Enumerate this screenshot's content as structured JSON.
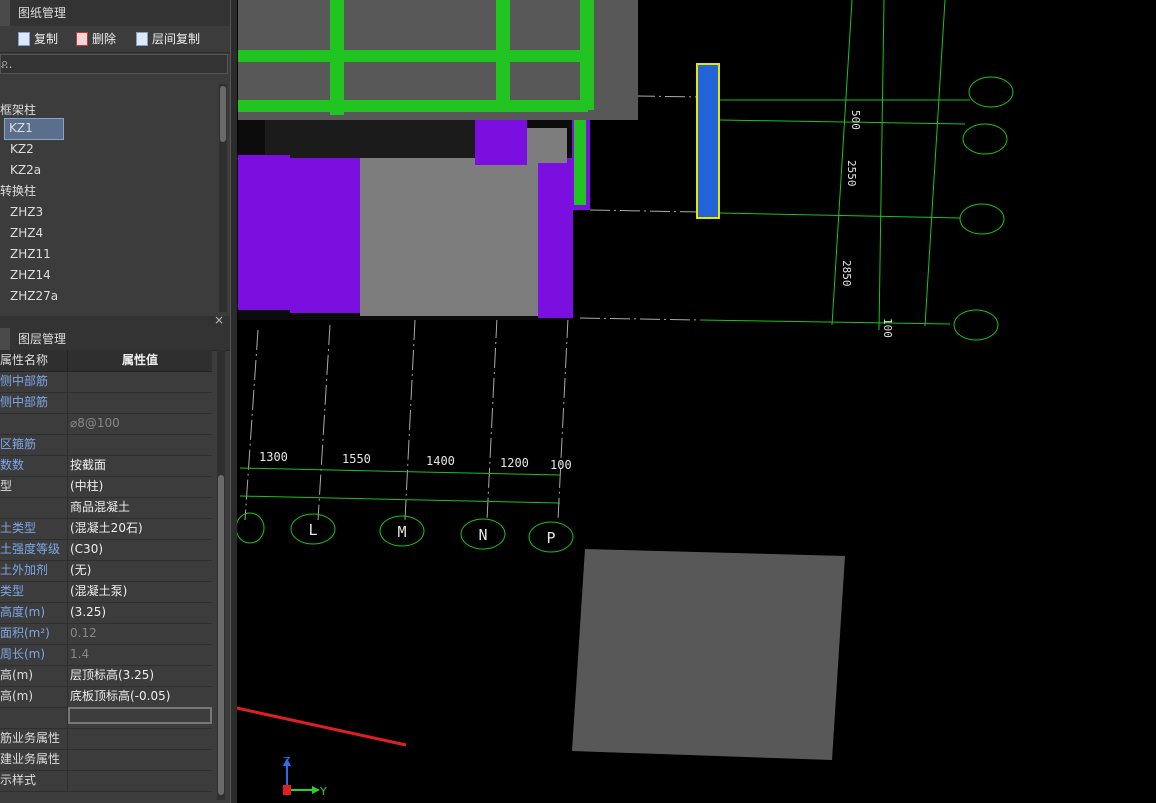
{
  "top_tabs": [
    "图纸管理"
  ],
  "toolbar": {
    "copy_label": "复制",
    "delete_label": "删除",
    "floor_copy_label": "层间复制"
  },
  "search": {
    "value": "..."
  },
  "tree": {
    "group1": "框架柱",
    "items1": [
      "KZ1",
      "KZ2",
      "KZ2a"
    ],
    "group2": "转换柱",
    "items2": [
      "ZHZ3",
      "ZHZ4",
      "ZHZ11",
      "ZHZ14",
      "ZHZ27a"
    ]
  },
  "bottom_tabs": [
    "图层管理"
  ],
  "props": {
    "col_name": "属性名称",
    "col_value": "属性值",
    "rows": [
      {
        "name": "侧中部筋",
        "value": ""
      },
      {
        "name": "侧中部筋",
        "value": ""
      },
      {
        "name": "",
        "value": "⌀8@100"
      },
      {
        "name": "区箍筋",
        "value": ""
      },
      {
        "name": "数数",
        "value": "按截面"
      },
      {
        "name": "型",
        "value": "(中柱)"
      },
      {
        "name": "",
        "value": "商品混凝土"
      },
      {
        "name": "土类型",
        "value": "(混凝土20石)"
      },
      {
        "name": "土强度等级",
        "value": "(C30)"
      },
      {
        "name": "土外加剂",
        "value": "(无)"
      },
      {
        "name": "类型",
        "value": "(混凝土泵)"
      },
      {
        "name": "高度(m)",
        "value": "(3.25)"
      },
      {
        "name": "面积(m²)",
        "value": "0.12"
      },
      {
        "name": "周长(m)",
        "value": "1.4"
      },
      {
        "name": "高(m)",
        "value": "层顶标高(3.25)"
      },
      {
        "name": "高(m)",
        "value": "底板顶标高(-0.05)"
      },
      {
        "name": "",
        "value": ""
      },
      {
        "name": "筋业务属性",
        "value": ""
      },
      {
        "name": "建业务属性",
        "value": ""
      },
      {
        "name": "示样式",
        "value": ""
      }
    ]
  },
  "cad": {
    "dims_bottom": [
      "1300",
      "1550",
      "1400",
      "1200",
      "100"
    ],
    "grid_bottom": [
      "L",
      "M",
      "N",
      "P"
    ],
    "dims_right": [
      "500",
      "2550",
      "2850",
      "100"
    ],
    "axis_labels": [
      "Z",
      "Y"
    ]
  },
  "colors": {
    "grid_line": "#19c419",
    "purple": "#7a0fe0",
    "green_fill": "#22c422",
    "column_blue": "#2364d8",
    "arrow": "#e02020"
  }
}
